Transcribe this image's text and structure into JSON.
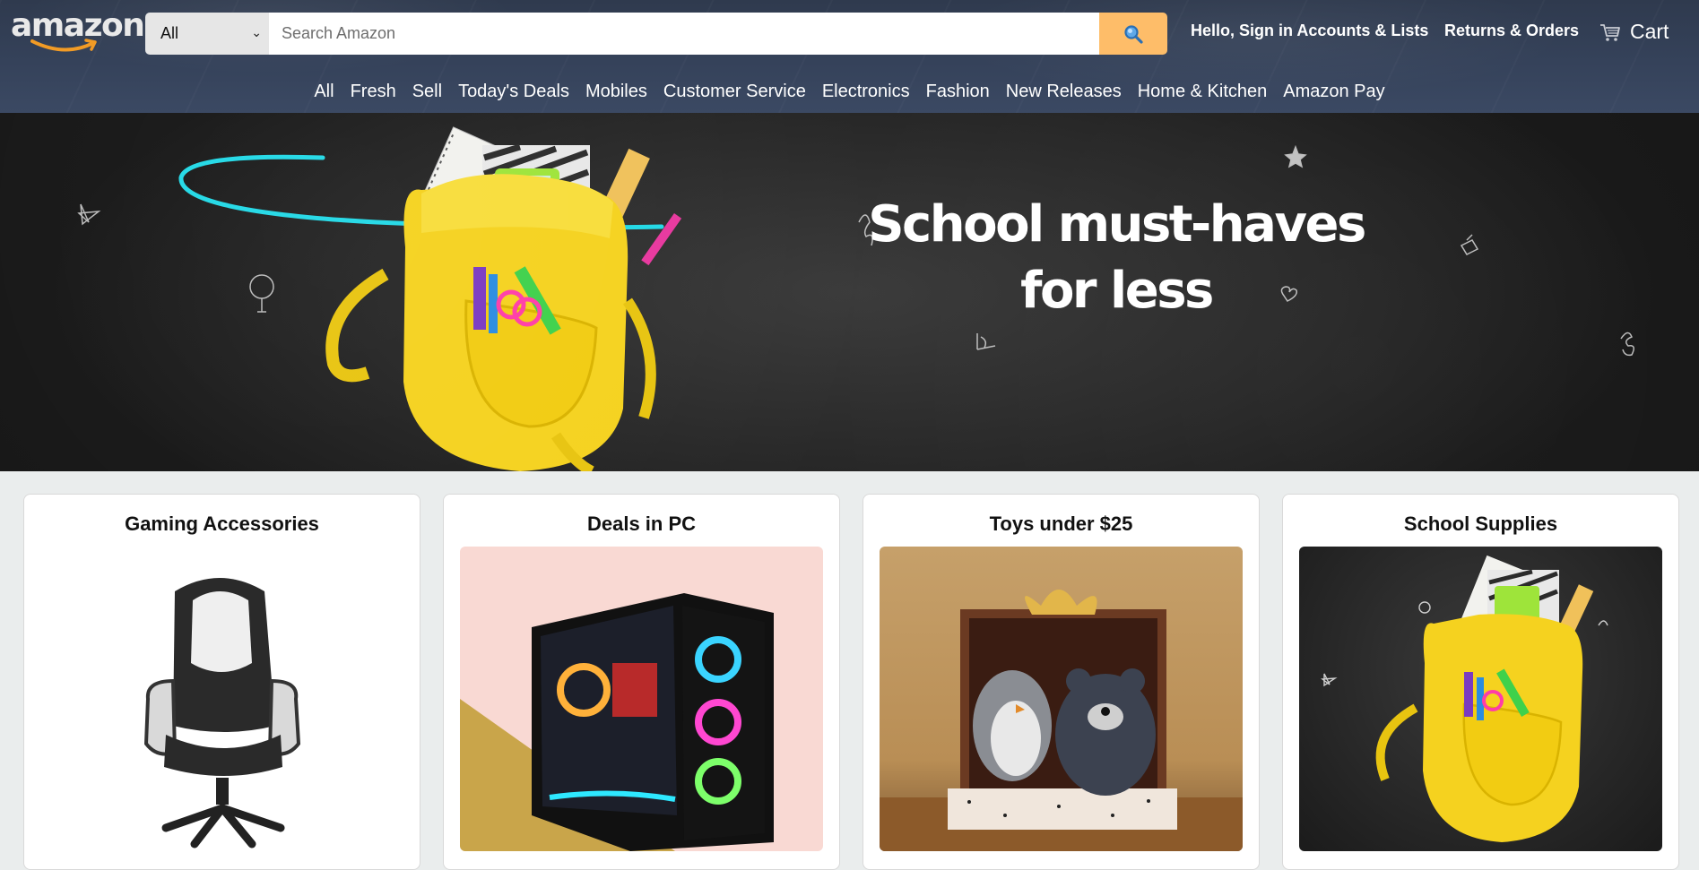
{
  "header": {
    "logo_text": "amazon",
    "search": {
      "category": "All",
      "placeholder": "Search Amazon",
      "button_icon": "search-icon"
    },
    "signin_label": "Hello, Sign in Accounts & Lists",
    "returns_label": "Returns & Orders",
    "cart_label": "Cart",
    "cart_icon": "cart-icon"
  },
  "subnav": {
    "items": [
      "All",
      "Fresh",
      "Sell",
      "Today's Deals",
      "Mobiles",
      "Customer Service",
      "Electronics",
      "Fashion",
      "New Releases",
      "Home & Kitchen",
      "Amazon Pay"
    ]
  },
  "hero": {
    "title_line1": "School must-haves",
    "title_line2": "for less"
  },
  "cards": [
    {
      "title": "Gaming Accessories",
      "image": "gaming-chair"
    },
    {
      "title": "Deals in PC",
      "image": "pc-case"
    },
    {
      "title": "Toys under $25",
      "image": "plush-toys"
    },
    {
      "title": "School Supplies",
      "image": "school-backpack"
    }
  ],
  "colors": {
    "header_bg": "#35425a",
    "search_button": "#febd69",
    "hero_bg": "#262626",
    "backpack_yellow": "#f5d21f"
  }
}
